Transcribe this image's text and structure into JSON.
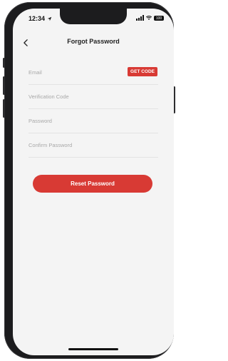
{
  "status_bar": {
    "time": "12:34",
    "battery": "100"
  },
  "nav": {
    "title": "Forgot Password",
    "back_icon": "chevron-left-icon"
  },
  "form": {
    "email": {
      "placeholder": "Email",
      "value": ""
    },
    "get_code_label": "GET CODE",
    "verification_code": {
      "placeholder": "Verification Code",
      "value": ""
    },
    "password": {
      "placeholder": "Password",
      "value": ""
    },
    "confirm_password": {
      "placeholder": "Confirm Password",
      "value": ""
    },
    "submit_label": "Reset Password"
  },
  "colors": {
    "accent": "#d83a34",
    "background": "#f4f4f4",
    "divider": "#e3e3e3"
  }
}
